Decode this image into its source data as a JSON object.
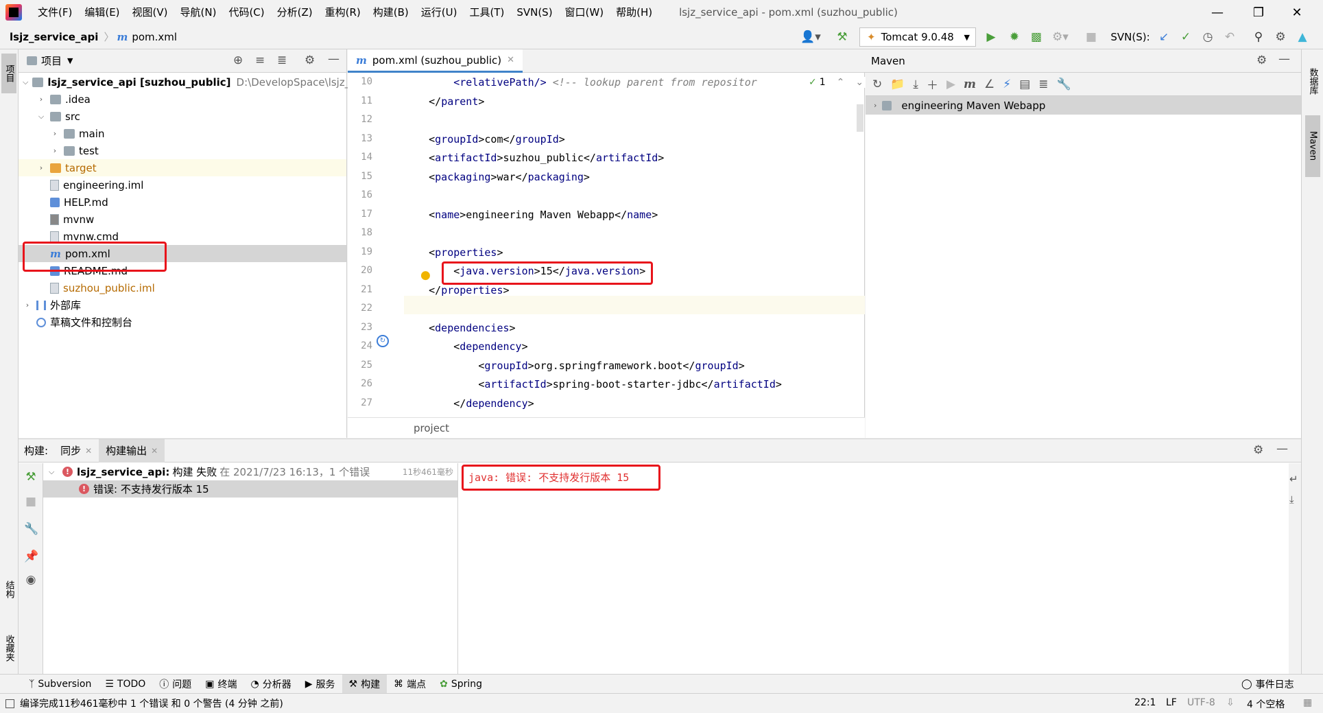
{
  "menu": {
    "items": [
      "文件(F)",
      "编辑(E)",
      "视图(V)",
      "导航(N)",
      "代码(C)",
      "分析(Z)",
      "重构(R)",
      "构建(B)",
      "运行(U)",
      "工具(T)",
      "SVN(S)",
      "窗口(W)",
      "帮助(H)"
    ],
    "window_title": "lsjz_service_api - pom.xml (suzhou_public)"
  },
  "navbar": {
    "project": "lsjz_service_api",
    "file": "pom.xml",
    "run_config": "Tomcat 9.0.48",
    "svn_label": "SVN(S):"
  },
  "left_stripe": {
    "project_tab": "项目",
    "structure_tab": "结构",
    "favorites_tab": "收藏夹"
  },
  "right_stripe": {
    "database_tab": "数据库",
    "maven_tab": "Maven"
  },
  "project_panel": {
    "title": "项目",
    "tree": [
      {
        "label": "lsjz_service_api [suzhou_public]",
        "hint": "D:\\DevelopSpace\\lsjz_ser"
      },
      {
        "label": ".idea"
      },
      {
        "label": "src"
      },
      {
        "label": "main"
      },
      {
        "label": "test"
      },
      {
        "label": "target"
      },
      {
        "label": "engineering.iml"
      },
      {
        "label": "HELP.md"
      },
      {
        "label": "mvnw"
      },
      {
        "label": "mvnw.cmd"
      },
      {
        "label": "pom.xml"
      },
      {
        "label": "README.md"
      },
      {
        "label": "suzhou_public.iml"
      },
      {
        "label": "外部库"
      },
      {
        "label": "草稿文件和控制台"
      }
    ]
  },
  "editor": {
    "tab_label": "pom.xml (suzhou_public)",
    "inspection_count": "1",
    "breadcrumb": "project",
    "line_numbers": [
      "10",
      "11",
      "12",
      "13",
      "14",
      "15",
      "16",
      "17",
      "18",
      "19",
      "20",
      "21",
      "22",
      "23",
      "24",
      "25",
      "26",
      "27"
    ],
    "lines": [
      {
        "indent": "        ",
        "tag_open": "<relativePath/>",
        "comment": " <!-- lookup parent from repositor"
      },
      {
        "indent": "    ",
        "t1": "</",
        "n1": "parent",
        "t2": ">"
      },
      {
        "text": ""
      },
      {
        "indent": "    ",
        "t1": "<",
        "n1": "groupId",
        "t2": ">com</",
        "n2": "groupId",
        "t3": ">"
      },
      {
        "indent": "    ",
        "t1": "<",
        "n1": "artifactId",
        "t2": ">suzhou_public</",
        "n2": "artifactId",
        "t3": ">"
      },
      {
        "indent": "    ",
        "t1": "<",
        "n1": "packaging",
        "t2": ">war</",
        "n2": "packaging",
        "t3": ">"
      },
      {
        "text": ""
      },
      {
        "indent": "    ",
        "t1": "<",
        "n1": "name",
        "t2": ">engineering Maven Webapp</",
        "n2": "name",
        "t3": ">"
      },
      {
        "text": ""
      },
      {
        "indent": "    ",
        "t1": "<",
        "n1": "properties",
        "t2": ">"
      },
      {
        "indent": "        ",
        "t1": "<",
        "n1": "java.version",
        "t2": ">15</",
        "n2": "java.version",
        "t3": ">"
      },
      {
        "indent": "    ",
        "t1": "</",
        "n1": "properties",
        "t2": ">"
      },
      {
        "text": ""
      },
      {
        "indent": "    ",
        "t1": "<",
        "n1": "dependencies",
        "t2": ">"
      },
      {
        "indent": "        ",
        "t1": "<",
        "n1": "dependency",
        "t2": ">"
      },
      {
        "indent": "            ",
        "t1": "<",
        "n1": "groupId",
        "t2": ">org.springframework.boot</",
        "n2": "groupId",
        "t3": ">"
      },
      {
        "indent": "            ",
        "t1": "<",
        "n1": "artifactId",
        "t2": ">spring-boot-starter-jdbc</",
        "n2": "artifactId",
        "t3": ">"
      },
      {
        "indent": "        ",
        "t1": "</",
        "n1": "dependency",
        "t2": ">"
      }
    ]
  },
  "maven_panel": {
    "title": "Maven",
    "project": "engineering Maven Webapp"
  },
  "build_panel": {
    "label": "构建:",
    "tabs": [
      "同步",
      "构建输出"
    ],
    "result_project": "lsjz_service_api:",
    "result_status": "构建 失败",
    "result_detail": "在 2021/7/23 16:13，1 个错误",
    "duration": "11秒461毫秒",
    "error_item": "错误: 不支持发行版本 15",
    "output": "java: 错误: 不支持发行版本 15"
  },
  "bottom_tabs": [
    "Subversion",
    "TODO",
    "问题",
    "终端",
    "分析器",
    "服务",
    "构建",
    "端点",
    "Spring"
  ],
  "event_log": "事件日志",
  "status": {
    "message": "编译完成11秒461毫秒中 1 个错误 和 0 个警告 (4 分钟 之前)",
    "position": "22:1",
    "line_sep": "LF",
    "encoding": "UTF-8",
    "indent": "4 个空格"
  },
  "colors": {
    "accent": "#4083c9",
    "error": "#db5860",
    "highlight_box": "#e8141b",
    "xml_tag": "#000080"
  }
}
